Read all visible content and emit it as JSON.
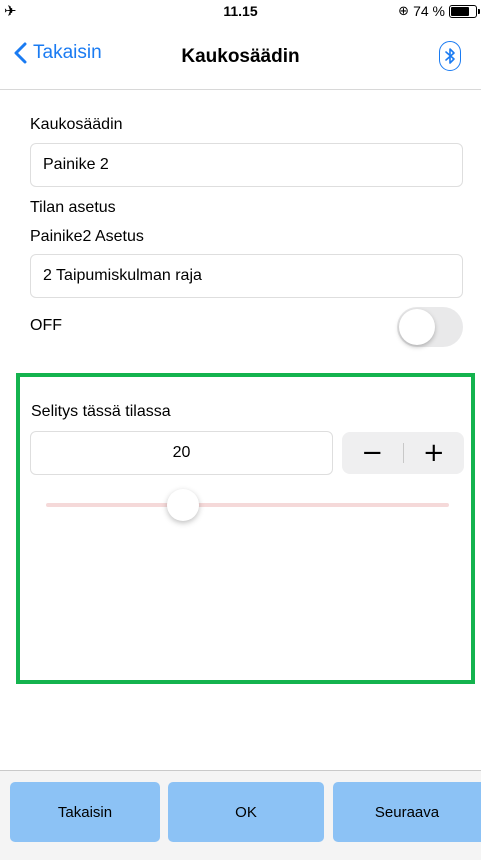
{
  "status_bar": {
    "time": "11.15",
    "battery_text": "74 %",
    "battery_level": 0.74,
    "icons": [
      "airplane-icon",
      "orientation-lock-icon",
      "battery-icon"
    ]
  },
  "nav": {
    "back_label": "Takaisin",
    "title": "Kaukosäädin",
    "right_icon": "bluetooth-icon",
    "accent_color": "#1a7bf2"
  },
  "form": {
    "remote_label": "Kaukosäädin",
    "remote_value": "Painike 2",
    "mode_setting_label": "Tilan asetus",
    "button_setting_label": "Painike2 Asetus",
    "button_setting_value": "2 Taipumiskulman raja",
    "switch_label": "OFF",
    "switch_on": false
  },
  "panel": {
    "border_color": "#14b34e",
    "title": "Selitys tässä tilassa",
    "value": "20",
    "stepper_minus": "−",
    "stepper_plus": "+",
    "slider_fraction": 0.34
  },
  "footer": {
    "back_label": "Takaisin",
    "ok_label": "OK",
    "next_label": "Seuraava",
    "button_color": "#8cc2f5"
  }
}
